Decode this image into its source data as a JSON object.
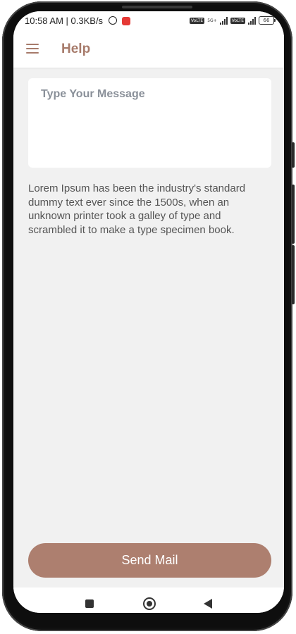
{
  "status_bar": {
    "time_text": "10:58 AM | 0.3KB/s",
    "network_labels": [
      "VoLTE",
      "5G+",
      "VoLTE"
    ],
    "battery_level": "66"
  },
  "app_bar": {
    "title": "Help",
    "menu_icon": "hamburger-menu-icon"
  },
  "form": {
    "message_placeholder": "Type Your Message",
    "message_value": "",
    "description": "Lorem Ipsum has been the industry's standard dummy text ever since the 1500s, when an unknown printer took a galley of type and scrambled it to make a type specimen book.",
    "send_button_label": "Send Mail"
  },
  "nav_bar": {
    "icons": [
      "recents-square-icon",
      "home-circle-icon",
      "back-triangle-icon"
    ]
  },
  "colors": {
    "accent": "#a77b6b",
    "button": "#ad7f6f",
    "background": "#f1f1f1",
    "placeholder": "#8a9099"
  }
}
